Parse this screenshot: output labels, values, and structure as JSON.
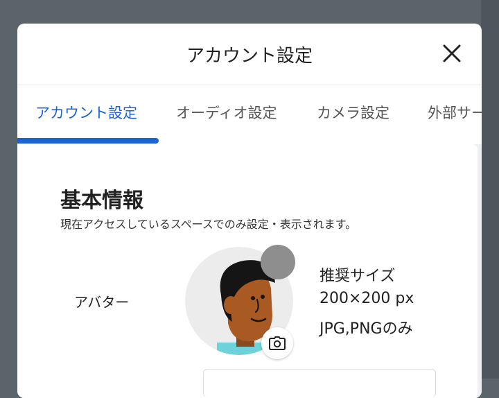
{
  "modal": {
    "title": "アカウント設定",
    "close_icon": "close-icon"
  },
  "tabs": [
    {
      "label": "アカウント設定",
      "active": true
    },
    {
      "label": "オーディオ設定",
      "active": false
    },
    {
      "label": "カメラ設定",
      "active": false
    },
    {
      "label": "外部サー",
      "active": false
    }
  ],
  "basic_info": {
    "title": "基本情報",
    "description": "現在アクセスしているスペースでのみ設定・表示されます。",
    "avatar_label": "アバター",
    "avatar_hint": [
      "推奨サイズ",
      "200×200 px",
      "JPG,PNGのみ"
    ],
    "camera_icon": "camera-icon"
  },
  "colors": {
    "accent": "#1b63d6",
    "backdrop": "#5b636b"
  }
}
